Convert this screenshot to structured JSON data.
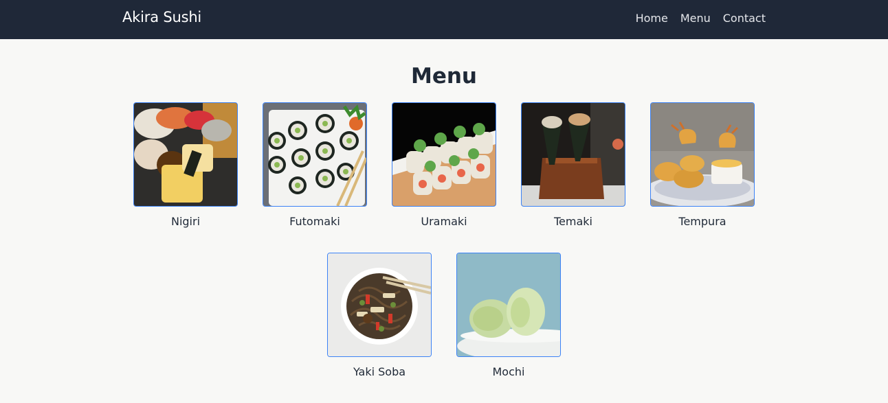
{
  "nav": {
    "brand": "Akira Sushi",
    "links": [
      "Home",
      "Menu",
      "Contact"
    ]
  },
  "page": {
    "title": "Menu"
  },
  "menu": {
    "items": [
      {
        "label": "Nigiri",
        "icon": "nigiri-image"
      },
      {
        "label": "Futomaki",
        "icon": "futomaki-image"
      },
      {
        "label": "Uramaki",
        "icon": "uramaki-image"
      },
      {
        "label": "Temaki",
        "icon": "temaki-image"
      },
      {
        "label": "Tempura",
        "icon": "tempura-image"
      },
      {
        "label": "Yaki Soba",
        "icon": "yaki-soba-image"
      },
      {
        "label": "Mochi",
        "icon": "mochi-image"
      }
    ]
  },
  "colors": {
    "navbar_bg": "#1f2838",
    "page_bg": "#f8f8f6",
    "thumb_border": "#3b82f6"
  }
}
